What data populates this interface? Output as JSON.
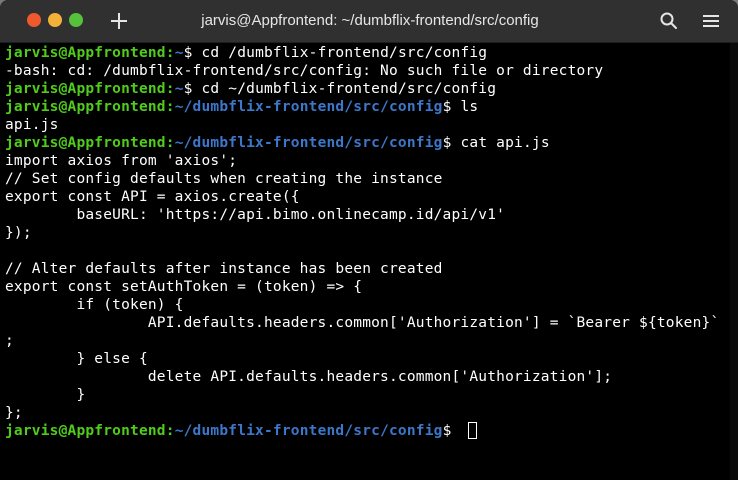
{
  "window": {
    "title": "jarvis@Appfrontend: ~/dumbflix-frontend/src/config"
  },
  "controls": {
    "close_color": "#ee5a2e",
    "minimize_color": "#f3b13a",
    "maximize_color": "#56c13a",
    "icons": [
      "new-tab-icon",
      "search-icon",
      "hamburger-menu-icon"
    ]
  },
  "colors": {
    "prompt_user": "#4fcd1a",
    "prompt_path": "#3c77c9",
    "text": "#ffffff",
    "background": "#000000"
  },
  "terminal": {
    "lines": [
      {
        "user": "jarvis@Appfrontend",
        "path": "~",
        "cmd": "$ cd /dumbflix-frontend/src/config"
      },
      {
        "text": "-bash: cd: /dumbflix-frontend/src/config: No such file or directory"
      },
      {
        "user": "jarvis@Appfrontend",
        "path": "~",
        "cmd": "$ cd ~/dumbflix-frontend/src/config"
      },
      {
        "user": "jarvis@Appfrontend",
        "path": "~/dumbflix-frontend/src/config",
        "cmd": "$ ls"
      },
      {
        "text": "api.js"
      },
      {
        "user": "jarvis@Appfrontend",
        "path": "~/dumbflix-frontend/src/config",
        "cmd": "$ cat api.js"
      },
      {
        "text": "import axios from 'axios';"
      },
      {
        "text": "// Set config defaults when creating the instance"
      },
      {
        "text": "export const API = axios.create({"
      },
      {
        "text": "        baseURL: 'https://api.bimo.onlinecamp.id/api/v1'"
      },
      {
        "text": "});"
      },
      {
        "text": ""
      },
      {
        "text": "// Alter defaults after instance has been created"
      },
      {
        "text": "export const setAuthToken = (token) => {"
      },
      {
        "text": "        if (token) {"
      },
      {
        "text": "                API.defaults.headers.common['Authorization'] = `Bearer ${token}`"
      },
      {
        "text": ";"
      },
      {
        "text": "        } else {"
      },
      {
        "text": "                delete API.defaults.headers.common['Authorization'];"
      },
      {
        "text": "        }"
      },
      {
        "text": "};"
      },
      {
        "user": "jarvis@Appfrontend",
        "path": "~/dumbflix-frontend/src/config",
        "cmd": "$ ",
        "cursor": true
      }
    ]
  }
}
